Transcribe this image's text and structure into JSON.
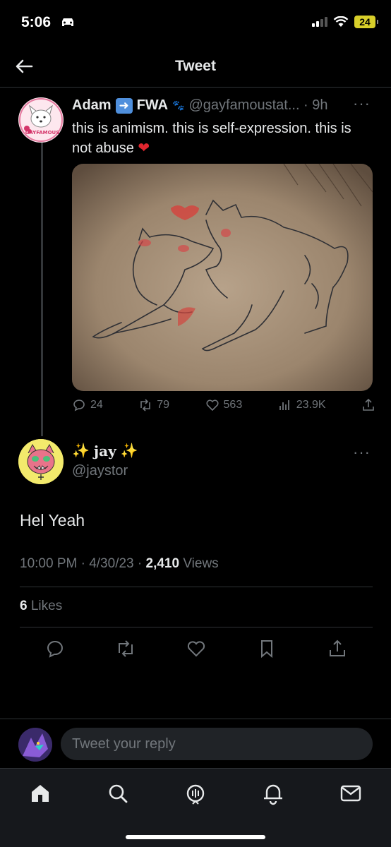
{
  "status_bar": {
    "time": "5:06",
    "battery": "24"
  },
  "nav": {
    "title": "Tweet"
  },
  "quoted_tweet": {
    "display_name": "Adam",
    "name_suffix": "FWA",
    "handle_time": "@gayfamoustat... · 9h",
    "text": "this is animism. this is self-expression. this is not abuse",
    "heart": "❤",
    "avatar_text": "GAYFAMOUS",
    "stats": {
      "replies": "24",
      "retweets": "79",
      "likes": "563",
      "views": "23.9K"
    }
  },
  "main_tweet": {
    "display_name": "jay",
    "sparkle": "✨",
    "handle": "@jaystor",
    "text": "Hel Yeah",
    "time_date": "10:00 PM · 4/30/23 · ",
    "views_count": "2,410",
    "views_label": " Views",
    "likes_count": "6",
    "likes_label": " Likes"
  },
  "reply": {
    "placeholder": "Tweet your reply"
  },
  "colors": {
    "background": "#000000",
    "text": "#e7e9ea",
    "muted": "#71767b",
    "divider": "#2f3336",
    "heart": "#e0262f",
    "battery": "#d8cf2a"
  },
  "icons": [
    "back-arrow-icon",
    "more-icon",
    "reply-icon",
    "retweet-icon",
    "like-icon",
    "views-icon",
    "share-icon",
    "bookmark-icon",
    "home-icon",
    "search-icon",
    "spaces-icon",
    "notifications-icon",
    "messages-icon"
  ]
}
